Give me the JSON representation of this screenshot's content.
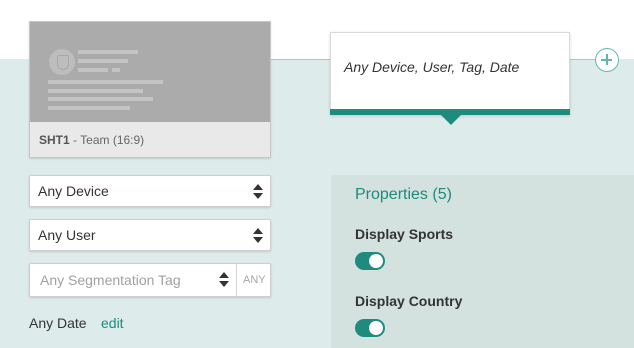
{
  "thumbnail": {
    "code": "SHT1",
    "caption": "- Team (16:9)"
  },
  "filters": {
    "device": "Any Device",
    "user": "Any User",
    "segmentation_placeholder": "Any Segmentation Tag",
    "any_label": "ANY",
    "date": "Any Date",
    "edit_label": "edit"
  },
  "summary": {
    "text": "Any Device, User, Tag, Date"
  },
  "properties": {
    "title": "Properties (5)",
    "items": [
      {
        "label": "Display Sports",
        "enabled": true
      },
      {
        "label": "Display Country",
        "enabled": true
      }
    ]
  },
  "colors": {
    "accent": "#1f8a7e",
    "panel_bg": "#ddebea",
    "properties_bg": "#d3e2df"
  },
  "icons": {
    "add": "plus-circle-icon",
    "select_arrows": "sort-arrows-icon"
  }
}
